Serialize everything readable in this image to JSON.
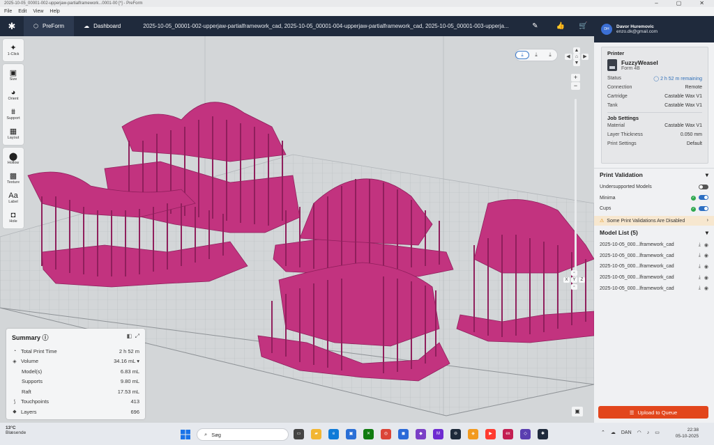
{
  "window": {
    "title": "2025-10-05_00001-002-upperjaw-partialframework...0001-00 [*] - PreForm"
  },
  "menu": [
    "File",
    "Edit",
    "View",
    "Help"
  ],
  "header": {
    "app_tab": "PreForm",
    "dashboard_tab": "Dashboard",
    "files_title": "2025-10-05_00001-002-upperjaw-partialframework_cad, 2025-10-05_00001-004-upperjaw-partialframework_cad, 2025-10-05_00001-003-upperja..."
  },
  "user": {
    "initials": "DH",
    "name": "Davor Huremovic",
    "email": "enzo.dk@gmail.com"
  },
  "toolbar": {
    "one_click": "1-Click",
    "size": "Size",
    "orient": "Orient",
    "support": "Support",
    "layout": "Layout",
    "hollow": "Hollow",
    "texture": "Texture",
    "label": "Label",
    "hole": "Hole"
  },
  "view_controls": {
    "axis": [
      "X",
      "Y",
      "Z"
    ]
  },
  "summary": {
    "title": "Summary",
    "rows": [
      {
        "label": "Total Print Time",
        "value": "2 h 52 m",
        "icon": "clock-icon"
      },
      {
        "label": "Volume",
        "value": "34.16 mL",
        "icon": "volume-icon"
      },
      {
        "label": "Model(s)",
        "value": "6.83 mL",
        "icon": ""
      },
      {
        "label": "Supports",
        "value": "9.80 mL",
        "icon": ""
      },
      {
        "label": "Raft",
        "value": "17.53 mL",
        "icon": ""
      },
      {
        "label": "Touchpoints",
        "value": "413",
        "icon": "touchpoint-icon"
      },
      {
        "label": "Layers",
        "value": "696",
        "icon": "layers-icon"
      }
    ]
  },
  "printer": {
    "section": "Printer",
    "name": "FuzzyWeasel",
    "model": "Form 4B",
    "status_label": "Status",
    "status_value": "2 h 52 m remaining",
    "connection_label": "Connection",
    "connection_value": "Remote",
    "cartridge_label": "Cartridge",
    "cartridge_value": "Castable Wax V1",
    "tank_label": "Tank",
    "tank_value": "Castable Wax V1"
  },
  "job": {
    "section": "Job Settings",
    "material_label": "Material",
    "material_value": "Castable Wax V1",
    "layer_label": "Layer Thickness",
    "layer_value": "0.050 mm",
    "settings_label": "Print Settings",
    "settings_value": "Default"
  },
  "validation": {
    "title": "Print Validation",
    "rows": [
      {
        "label": "Undersupported Models",
        "on": false,
        "check": false
      },
      {
        "label": "Minima",
        "on": true,
        "check": true
      },
      {
        "label": "Cups",
        "on": true,
        "check": true
      }
    ],
    "warning": "Some Print Validations Are Disabled"
  },
  "models": {
    "title": "Model List (5)",
    "items": [
      "2025-10-05_000...lframework_cad",
      "2025-10-05_000...lframework_cad",
      "2025-10-05_000...lframework_cad",
      "2025-10-05_000...lframework_cad",
      "2025-10-05_000...lframework_cad"
    ]
  },
  "upload_button": "Upload to Queue",
  "taskbar": {
    "weather_temp": "13°C",
    "weather_text": "Blæsende",
    "search": "Søg",
    "lang": "DAN",
    "time": "22:38",
    "date": "05-10-2025"
  },
  "colors": {
    "accent": "#2d6fc2",
    "upload": "#e2461c",
    "header": "#1f2a3c",
    "model": "#c2337f"
  }
}
